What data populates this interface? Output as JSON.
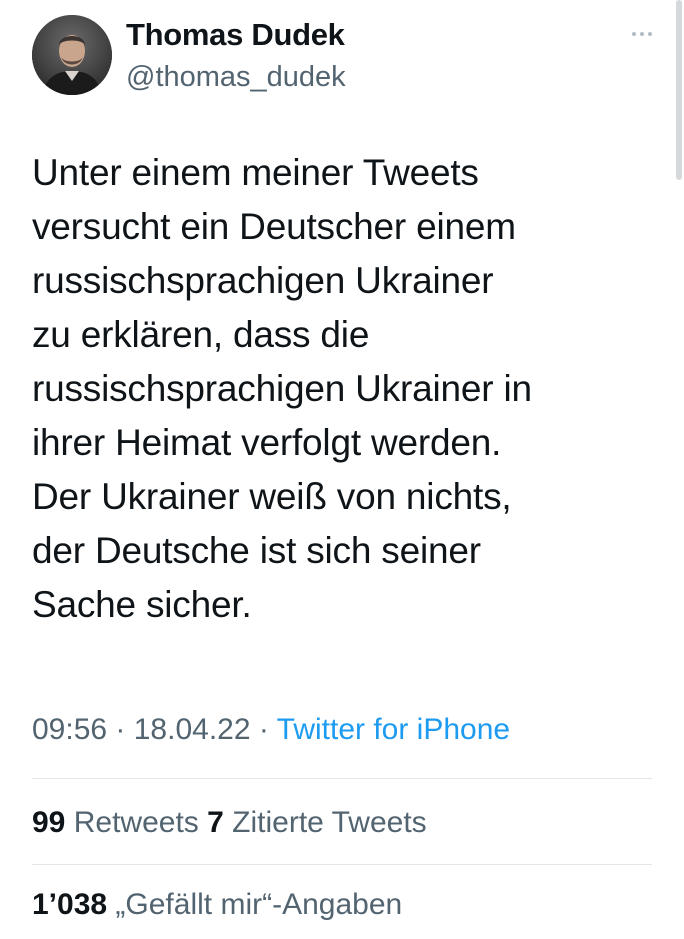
{
  "author": {
    "name": "Thomas Dudek",
    "handle": "@thomas_dudek",
    "avatar_icon": "profile-photo"
  },
  "more_icon": "ellipsis-icon",
  "tweet": {
    "text": "Unter einem meiner Tweets\nversucht ein Deutscher einem\nrussischsprachigen Ukrainer\nzu erklären, dass die\nrussischsprachigen Ukrainer in\nihrer Heimat verfolgt werden.\nDer Ukrainer weiß von nichts,\nder Deutsche ist sich seiner\nSache sicher.",
    "time": "09:56",
    "separator": " · ",
    "date": "18.04.22",
    "source": "Twitter for iPhone"
  },
  "stats": {
    "retweets_count": "99",
    "retweets_label": "Retweets",
    "quotes_count": "7",
    "quotes_label": "Zitierte Tweets",
    "likes_count": "1’038",
    "likes_label": "„Gefällt mir“-Angaben"
  },
  "colors": {
    "text": "#0f1419",
    "secondary": "#536471",
    "link": "#1d9bf0",
    "divider": "#e1e6ea"
  }
}
